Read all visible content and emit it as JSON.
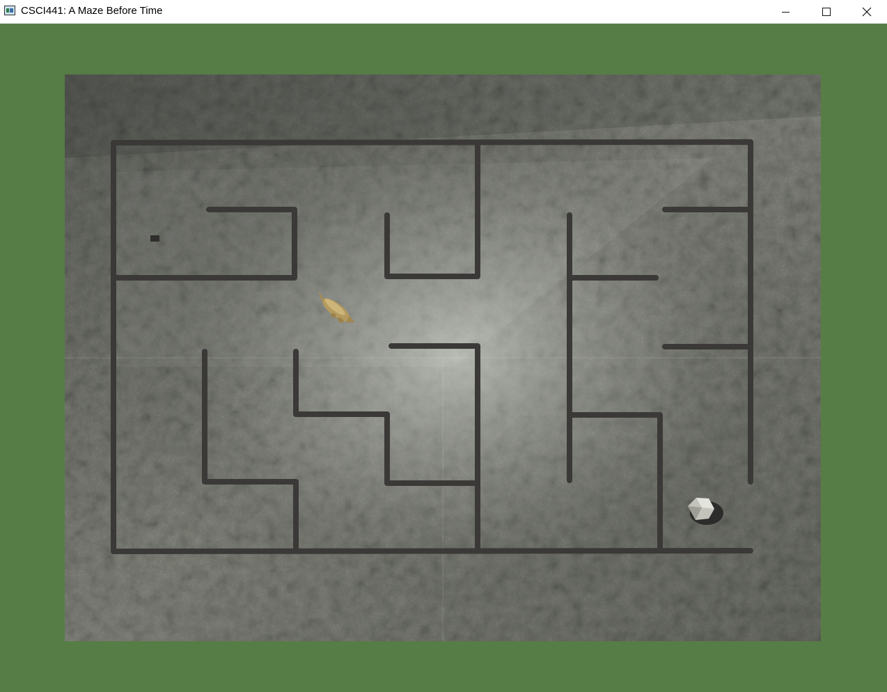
{
  "window": {
    "title": "CSCI441: A Maze Before Time",
    "background_color": "#567d45"
  },
  "controls": {
    "minimize_icon": "minimize-icon",
    "maximize_icon": "maximize-icon",
    "close_icon": "close-icon"
  },
  "scene": {
    "floor_texture": "stone-rock-texture",
    "wall_color": "#3b3937",
    "player": "dinosaur-character",
    "goal": "boulder-rock"
  }
}
